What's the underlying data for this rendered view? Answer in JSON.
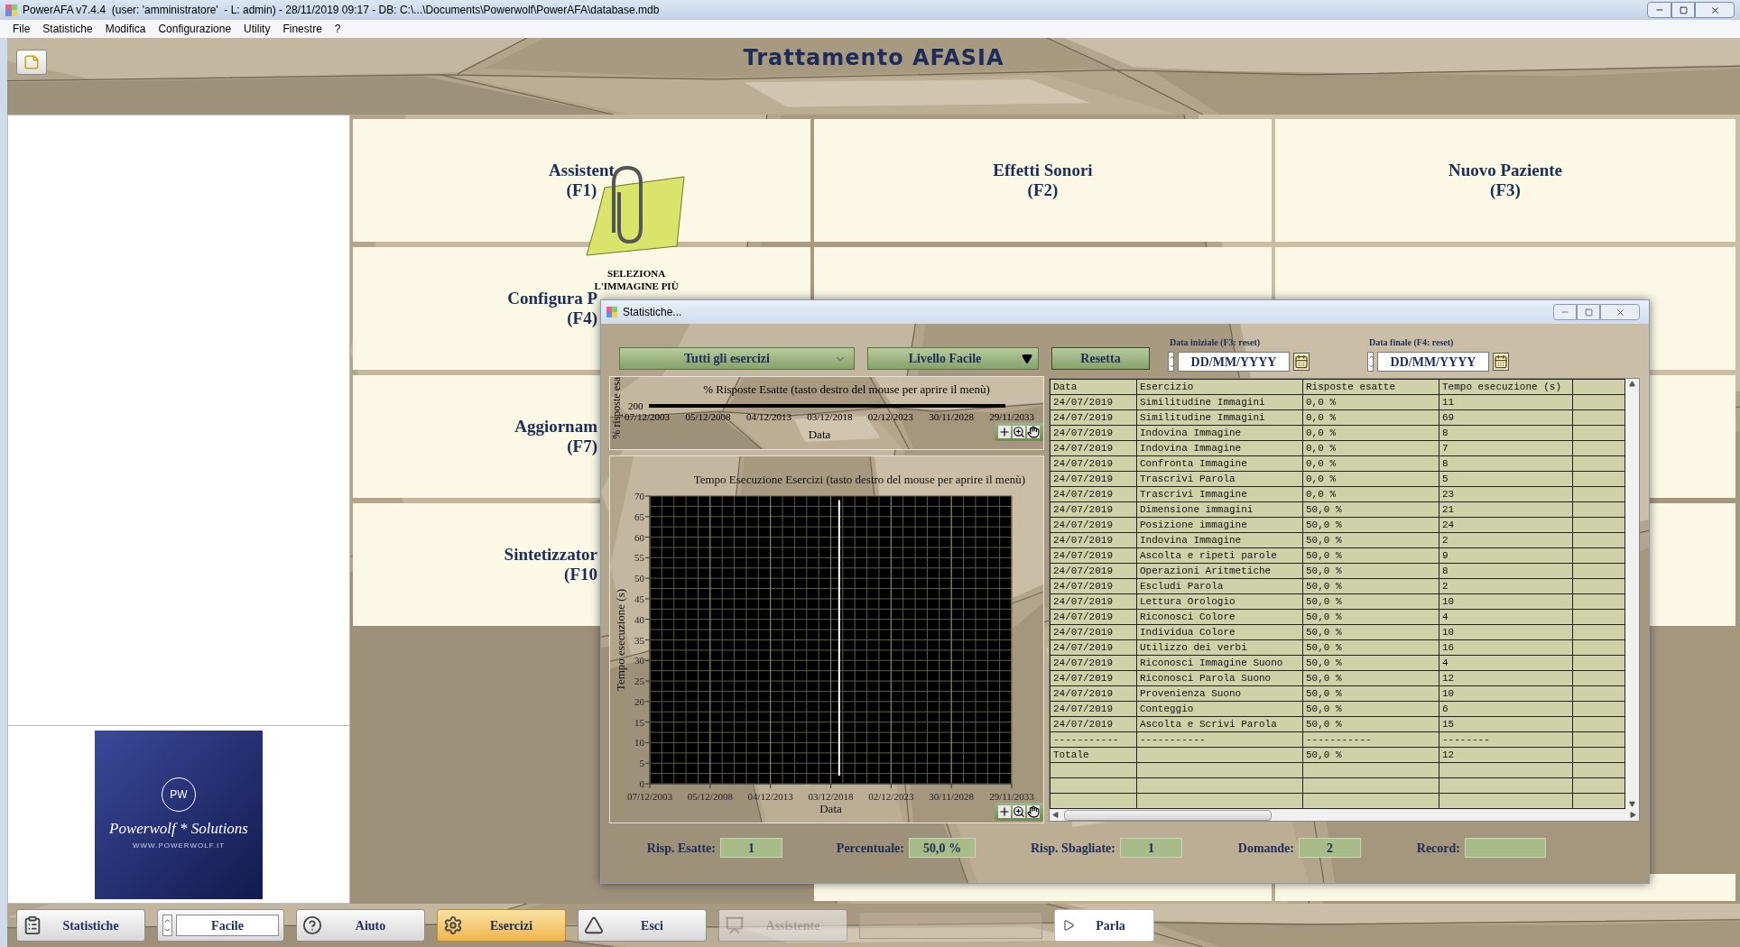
{
  "window": {
    "title": "PowerAFA v7.4.4  (user: 'amministratore'  - L: admin) - 28/11/2019 09:17 - DB: C:\\...\\Documents\\Powerwolf\\PowerAFA\\database.mdb"
  },
  "menu": [
    "File",
    "Statistiche",
    "Modifica",
    "Configurazione",
    "Utility",
    "Finestre",
    "?"
  ],
  "header": {
    "title": "Trattamento AFASIA"
  },
  "logo": {
    "initials": "PW",
    "name": "Powerwolf * Solutions",
    "url": "WWW.POWERWOLF.IT"
  },
  "assistant_caption": "SELEZIONA L'IMMAGINE PIÙ",
  "tiles": [
    {
      "kind": "label",
      "label": "Assistent",
      "key": "(F1)"
    },
    {
      "kind": "label",
      "label": "Effetti Sonori",
      "key": "(F2)"
    },
    {
      "kind": "label",
      "label": "Nuovo Paziente",
      "key": "(F3)"
    },
    {
      "kind": "covered",
      "label": "Configura P",
      "key": "(F4)"
    },
    {
      "kind": "blank"
    },
    {
      "kind": "blank"
    },
    {
      "kind": "covered",
      "label": "Aggiornam",
      "key": "(F7)"
    },
    {
      "kind": "blank"
    },
    {
      "kind": "blank"
    },
    {
      "kind": "covered",
      "label": "Sintetizzator",
      "key": "(F10"
    },
    {
      "kind": "blank"
    },
    {
      "kind": "blank"
    }
  ],
  "dialog": {
    "title": "Statistiche...",
    "exercise_filter": "Tutti gli esercizi",
    "level_filter": "Livello Facile",
    "reset_button": "Resetta",
    "start_date": {
      "label": "Data iniziale (F3: reset)",
      "value": "DD/MM/YYYY"
    },
    "end_date": {
      "label": "Data finale (F4: reset)",
      "value": "DD/MM/YYYY"
    },
    "small_chart": {
      "title": "% Risposte Esatte (tasto destro del mouse per aprire il menù)",
      "ylabel": "% risposte esa",
      "ytick": "200",
      "xticks": [
        "07/12/2003",
        "05/12/2008",
        "04/12/2013",
        "03/12/2018",
        "02/12/2023",
        "30/11/2028",
        "29/11/2033"
      ],
      "xlabel": "Data"
    },
    "chart": {
      "chart_data": {
        "type": "line",
        "title": "Tempo Esecuzione Esercizi (tasto destro del mouse per aprire il menù)",
        "xlabel": "Data",
        "ylabel": "Tempo esecuzione (s)",
        "categories": [
          "07/12/2003",
          null,
          null,
          null,
          null,
          "05/12/2008",
          null,
          null,
          null,
          null,
          "04/12/2013",
          null,
          null,
          null,
          null,
          "03/12/2018",
          null,
          null,
          null,
          null,
          "02/12/2023",
          null,
          null,
          null,
          null,
          "30/11/2028",
          null,
          null,
          null,
          null,
          "29/11/2033"
        ],
        "ylim": [
          0,
          70
        ],
        "grid": true,
        "yticks": [
          0,
          5,
          10,
          15,
          20,
          25,
          30,
          35,
          40,
          45,
          50,
          55,
          60,
          65,
          70
        ]
      }
    },
    "table": {
      "columns": [
        "Data",
        "Esercizio",
        "Risposte esatte",
        "Tempo esecuzione (s)"
      ],
      "rows": [
        [
          "24/07/2019",
          "Similitudine Immagini",
          "0,0 %",
          "11"
        ],
        [
          "24/07/2019",
          "Similitudine Immagini",
          "0,0 %",
          "69"
        ],
        [
          "24/07/2019",
          "Indovina Immagine",
          "0,0 %",
          "8"
        ],
        [
          "24/07/2019",
          "Indovina Immagine",
          "0,0 %",
          "7"
        ],
        [
          "24/07/2019",
          "Confronta Immagine",
          "0,0 %",
          "8"
        ],
        [
          "24/07/2019",
          "Trascrivi Parola",
          "0,0 %",
          "5"
        ],
        [
          "24/07/2019",
          "Trascrivi Immagine",
          "0,0 %",
          "23"
        ],
        [
          "24/07/2019",
          "Dimensione immagini",
          "50,0 %",
          "21"
        ],
        [
          "24/07/2019",
          "Posizione immagine",
          "50,0 %",
          "24"
        ],
        [
          "24/07/2019",
          "Indovina Immagine",
          "50,0 %",
          "2"
        ],
        [
          "24/07/2019",
          "Ascolta e ripeti parole",
          "50,0 %",
          "9"
        ],
        [
          "24/07/2019",
          "Operazioni Aritmetiche",
          "50,0 %",
          "8"
        ],
        [
          "24/07/2019",
          "Escludi Parola",
          "50,0 %",
          "2"
        ],
        [
          "24/07/2019",
          "Lettura Orologio",
          "50,0 %",
          "10"
        ],
        [
          "24/07/2019",
          "Riconosci Colore",
          "50,0 %",
          "4"
        ],
        [
          "24/07/2019",
          "Individua Colore",
          "50,0 %",
          "10"
        ],
        [
          "24/07/2019",
          "Utilizzo dei verbi",
          "50,0 %",
          "16"
        ],
        [
          "24/07/2019",
          "Riconosci Immagine Suono",
          "50,0 %",
          "4"
        ],
        [
          "24/07/2019",
          "Riconosci Parola Suono",
          "50,0 %",
          "12"
        ],
        [
          "24/07/2019",
          "Provenienza Suono",
          "50,0 %",
          "10"
        ],
        [
          "24/07/2019",
          "Conteggio",
          "50,0 %",
          "6"
        ],
        [
          "24/07/2019",
          "Ascolta e Scrivi Parola",
          "50,0 %",
          "15"
        ]
      ],
      "separator": [
        "-----------",
        "-----------",
        "-----------",
        "--------"
      ],
      "total": {
        "label": "Totale",
        "correct": "50,0 %",
        "time": "12"
      }
    },
    "stats": [
      {
        "label": "Risp. Esatte:",
        "value": "1"
      },
      {
        "label": "Percentuale:",
        "value": "50,0 %"
      },
      {
        "label": "Risp. Sbagliate:",
        "value": "1"
      },
      {
        "label": "Domande:",
        "value": "2"
      },
      {
        "label": "Record:"
      }
    ]
  },
  "toolbar": [
    {
      "kind": "button",
      "label": "Statistiche",
      "selected": false,
      "disabled": false
    },
    {
      "kind": "spinner",
      "label": "Facile",
      "selected": false,
      "disabled": false
    },
    {
      "kind": "button",
      "label": "Aiuto",
      "selected": false,
      "disabled": false
    },
    {
      "kind": "button",
      "label": "Esercizi",
      "selected": true,
      "disabled": false
    },
    {
      "kind": "button",
      "label": "Esci",
      "selected": false,
      "disabled": false
    },
    {
      "kind": "button",
      "label": "Assistente",
      "selected": false,
      "disabled": true
    },
    {
      "kind": "field"
    },
    {
      "kind": "play",
      "label": "Parla",
      "selected": false,
      "disabled": false
    }
  ]
}
